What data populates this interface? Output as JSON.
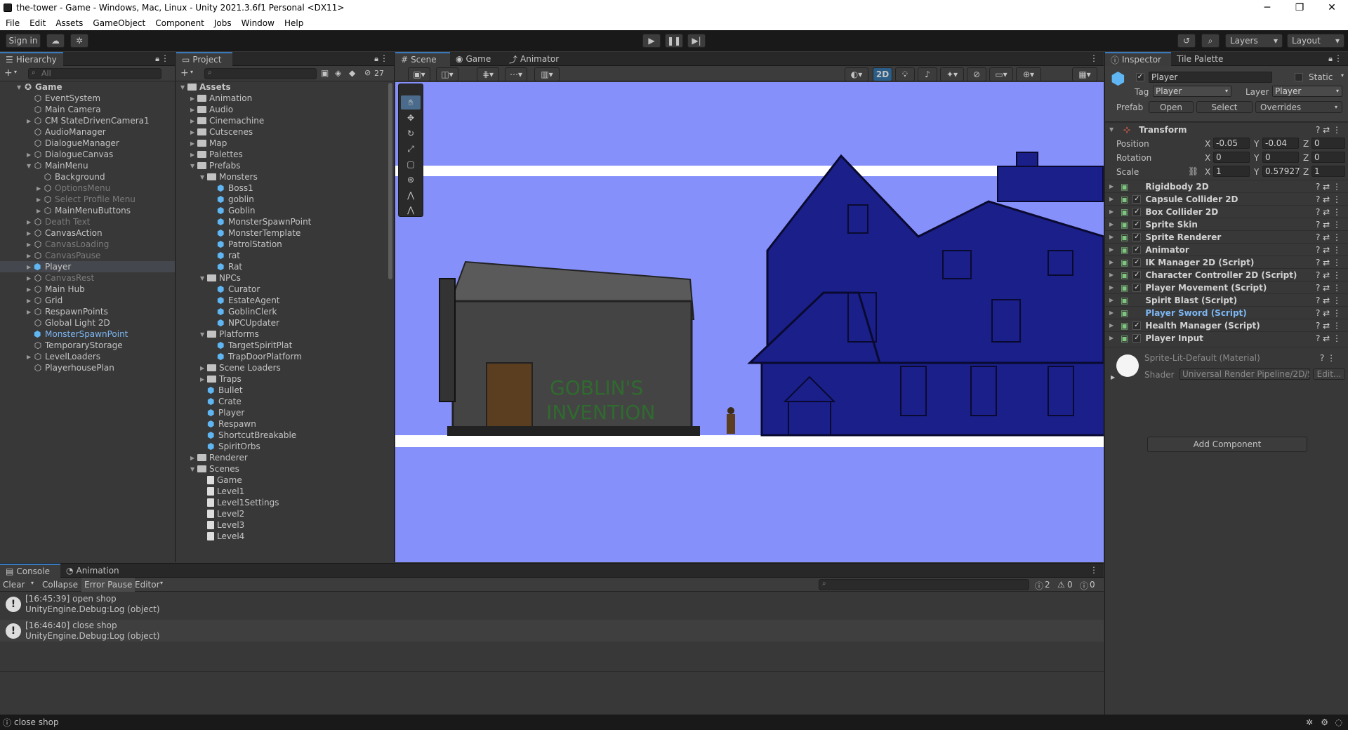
{
  "window": {
    "title": "the-tower - Game - Windows, Mac, Linux - Unity 2021.3.6f1 Personal <DX11>",
    "minimize": "─",
    "maximize": "❐",
    "close": "✕"
  },
  "menu": [
    "File",
    "Edit",
    "Assets",
    "GameObject",
    "Component",
    "Jobs",
    "Window",
    "Help"
  ],
  "toolbar": {
    "sign_in": "Sign in",
    "layers": "Layers",
    "layout": "Layout"
  },
  "hierarchy": {
    "tab": "Hierarchy",
    "search_placeholder": "All",
    "items": [
      {
        "label": "Game",
        "indent": 0,
        "type": "scene",
        "expanded": true,
        "bold": true
      },
      {
        "label": "EventSystem",
        "indent": 1,
        "type": "go"
      },
      {
        "label": "Main Camera",
        "indent": 1,
        "type": "go"
      },
      {
        "label": "CM StateDrivenCamera1",
        "indent": 1,
        "type": "go",
        "arrow": true
      },
      {
        "label": "AudioManager",
        "indent": 1,
        "type": "go"
      },
      {
        "label": "DialogueManager",
        "indent": 1,
        "type": "go"
      },
      {
        "label": "DialogueCanvas",
        "indent": 1,
        "type": "go",
        "arrow": true
      },
      {
        "label": "MainMenu",
        "indent": 1,
        "type": "go",
        "arrow": true,
        "expanded": true
      },
      {
        "label": "Background",
        "indent": 2,
        "type": "go"
      },
      {
        "label": "OptionsMenu",
        "indent": 2,
        "type": "go",
        "dim": true,
        "arrow": true
      },
      {
        "label": "Select Profile Menu",
        "indent": 2,
        "type": "go",
        "dim": true,
        "arrow": true
      },
      {
        "label": "MainMenuButtons",
        "indent": 2,
        "type": "go",
        "arrow": true
      },
      {
        "label": "Death Text",
        "indent": 1,
        "type": "go",
        "dim": true,
        "arrow": true
      },
      {
        "label": "CanvasAction",
        "indent": 1,
        "type": "go",
        "arrow": true
      },
      {
        "label": "CanvasLoading",
        "indent": 1,
        "type": "go",
        "dim": true,
        "arrow": true
      },
      {
        "label": "CanvasPause",
        "indent": 1,
        "type": "go",
        "dim": true,
        "arrow": true
      },
      {
        "label": "Player",
        "indent": 1,
        "type": "prefab",
        "arrow": true,
        "selected": true
      },
      {
        "label": "CanvasRest",
        "indent": 1,
        "type": "go",
        "dim": true,
        "arrow": true
      },
      {
        "label": "Main Hub",
        "indent": 1,
        "type": "go",
        "arrow": true
      },
      {
        "label": "Grid",
        "indent": 1,
        "type": "go",
        "arrow": true
      },
      {
        "label": "RespawnPoints",
        "indent": 1,
        "type": "go",
        "arrow": true
      },
      {
        "label": "Global Light 2D",
        "indent": 1,
        "type": "go"
      },
      {
        "label": "MonsterSpawnPoint",
        "indent": 1,
        "type": "prefab",
        "blue": true
      },
      {
        "label": "TemporaryStorage",
        "indent": 1,
        "type": "go"
      },
      {
        "label": "LevelLoaders",
        "indent": 1,
        "type": "go",
        "arrow": true
      },
      {
        "label": "PlayerhousePlan",
        "indent": 1,
        "type": "go"
      }
    ]
  },
  "project": {
    "tab": "Project",
    "badge": "27",
    "items": [
      {
        "label": "Assets",
        "indent": 0,
        "type": "folder",
        "expanded": true,
        "bold": true
      },
      {
        "label": "Animation",
        "indent": 1,
        "type": "folder",
        "arrow": true
      },
      {
        "label": "Audio",
        "indent": 1,
        "type": "folder",
        "arrow": true
      },
      {
        "label": "Cinemachine",
        "indent": 1,
        "type": "folder",
        "arrow": true
      },
      {
        "label": "Cutscenes",
        "indent": 1,
        "type": "folder",
        "arrow": true
      },
      {
        "label": "Map",
        "indent": 1,
        "type": "folder",
        "arrow": true
      },
      {
        "label": "Palettes",
        "indent": 1,
        "type": "folder",
        "arrow": true
      },
      {
        "label": "Prefabs",
        "indent": 1,
        "type": "folder",
        "expanded": true
      },
      {
        "label": "Monsters",
        "indent": 2,
        "type": "folder",
        "expanded": true
      },
      {
        "label": "Boss1",
        "indent": 3,
        "type": "prefab"
      },
      {
        "label": "goblin",
        "indent": 3,
        "type": "prefab"
      },
      {
        "label": "Goblin",
        "indent": 3,
        "type": "prefab"
      },
      {
        "label": "MonsterSpawnPoint",
        "indent": 3,
        "type": "prefab"
      },
      {
        "label": "MonsterTemplate",
        "indent": 3,
        "type": "prefab"
      },
      {
        "label": "PatrolStation",
        "indent": 3,
        "type": "prefab"
      },
      {
        "label": "rat",
        "indent": 3,
        "type": "prefab"
      },
      {
        "label": "Rat",
        "indent": 3,
        "type": "prefab"
      },
      {
        "label": "NPCs",
        "indent": 2,
        "type": "folder",
        "expanded": true
      },
      {
        "label": "Curator",
        "indent": 3,
        "type": "prefab"
      },
      {
        "label": "EstateAgent",
        "indent": 3,
        "type": "prefab"
      },
      {
        "label": "GoblinClerk",
        "indent": 3,
        "type": "prefab"
      },
      {
        "label": "NPCUpdater",
        "indent": 3,
        "type": "prefab"
      },
      {
        "label": "Platforms",
        "indent": 2,
        "type": "folder",
        "expanded": true
      },
      {
        "label": "TargetSpiritPlat",
        "indent": 3,
        "type": "prefab"
      },
      {
        "label": "TrapDoorPlatform",
        "indent": 3,
        "type": "prefab"
      },
      {
        "label": "Scene Loaders",
        "indent": 2,
        "type": "folder",
        "arrow": true
      },
      {
        "label": "Traps",
        "indent": 2,
        "type": "folder",
        "arrow": true
      },
      {
        "label": "Bullet",
        "indent": 2,
        "type": "prefab"
      },
      {
        "label": "Crate",
        "indent": 2,
        "type": "prefab"
      },
      {
        "label": "Player",
        "indent": 2,
        "type": "prefab"
      },
      {
        "label": "Respawn",
        "indent": 2,
        "type": "prefab"
      },
      {
        "label": "ShortcutBreakable",
        "indent": 2,
        "type": "prefab"
      },
      {
        "label": "SpiritOrbs",
        "indent": 2,
        "type": "prefab"
      },
      {
        "label": "Renderer",
        "indent": 1,
        "type": "folder",
        "arrow": true
      },
      {
        "label": "Scenes",
        "indent": 1,
        "type": "folder",
        "expanded": true
      },
      {
        "label": "Game",
        "indent": 2,
        "type": "scene"
      },
      {
        "label": "Level1",
        "indent": 2,
        "type": "scene"
      },
      {
        "label": "Level1Settings",
        "indent": 2,
        "type": "scene"
      },
      {
        "label": "Level2",
        "indent": 2,
        "type": "scene"
      },
      {
        "label": "Level3",
        "indent": 2,
        "type": "scene"
      },
      {
        "label": "Level4",
        "indent": 2,
        "type": "scene"
      }
    ]
  },
  "scene": {
    "tabs": [
      "Scene",
      "Game",
      "Animator"
    ],
    "mode_2d": "2D",
    "sign_text_line1": "GOBLIN'S",
    "sign_text_line2": "INVENTION"
  },
  "inspector": {
    "tabs": [
      "Inspector",
      "Tile Palette"
    ],
    "object_name": "Player",
    "static_label": "Static",
    "tag_label": "Tag",
    "tag_value": "Player",
    "layer_label": "Layer",
    "layer_value": "Player",
    "prefab_label": "Prefab",
    "open": "Open",
    "select": "Select",
    "overrides": "Overrides",
    "transform": {
      "title": "Transform",
      "position": {
        "label": "Position",
        "x": "-0.05",
        "y": "-0.04",
        "z": "0"
      },
      "rotation": {
        "label": "Rotation",
        "x": "0",
        "y": "0",
        "z": "0"
      },
      "scale": {
        "label": "Scale",
        "x": "1",
        "y": "0.57927",
        "z": "1"
      }
    },
    "components": [
      {
        "name": "Rigidbody 2D",
        "check": false
      },
      {
        "name": "Capsule Collider 2D",
        "check": true
      },
      {
        "name": "Box Collider 2D",
        "check": true
      },
      {
        "name": "Sprite Skin",
        "check": true
      },
      {
        "name": "Sprite Renderer",
        "check": true
      },
      {
        "name": "Animator",
        "check": true
      },
      {
        "name": "IK Manager 2D (Script)",
        "check": true
      },
      {
        "name": "Character Controller 2D (Script)",
        "check": true
      },
      {
        "name": "Player Movement (Script)",
        "check": true
      },
      {
        "name": "Spirit Blast (Script)",
        "check": false
      },
      {
        "name": "Player Sword (Script)",
        "check": false,
        "blue": true
      },
      {
        "name": "Health Manager (Script)",
        "check": true
      },
      {
        "name": "Player Input",
        "check": true
      }
    ],
    "material": {
      "name": "Sprite-Lit-Default (Material)",
      "shader_label": "Shader",
      "shader_value": "Universal Render Pipeline/2D/S",
      "edit": "Edit..."
    },
    "add_component": "Add Component"
  },
  "console": {
    "tabs": [
      "Console",
      "Animation"
    ],
    "clear": "Clear",
    "collapse": "Collapse",
    "error_pause": "Error Pause",
    "editor": "Editor",
    "count_info": "2",
    "count_warn": "0",
    "count_err": "0",
    "logs": [
      {
        "line1": "[16:45:39] open shop",
        "line2": "UnityEngine.Debug:Log (object)"
      },
      {
        "line1": "[16:46:40] close shop",
        "line2": "UnityEngine.Debug:Log (object)"
      }
    ]
  },
  "status": {
    "text": "close shop"
  },
  "colors": {
    "sky": "#8690fa",
    "house": "#1a1f8a",
    "selection": "#3a79bb"
  }
}
